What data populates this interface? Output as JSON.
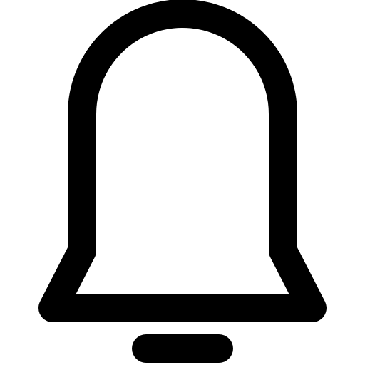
{
  "icon": {
    "name": "bell-icon",
    "stroke_color": "#000000",
    "fill_color": "#ffffff",
    "background_color": "#ffffff"
  }
}
